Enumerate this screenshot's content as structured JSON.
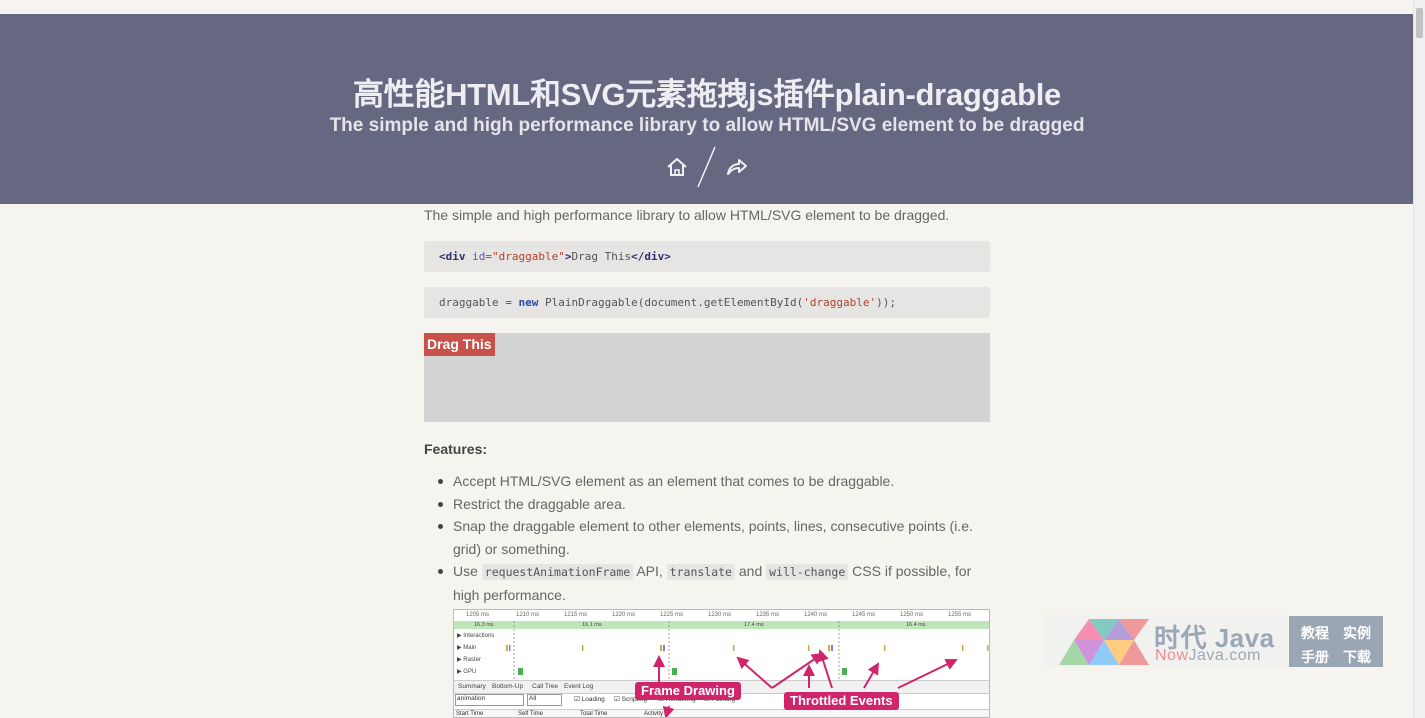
{
  "hero": {
    "title": "高性能HTML和SVG元素拖拽js插件plain-draggable",
    "subtitle": "The simple and high performance library to allow HTML/SVG element to be dragged",
    "icons": [
      "home-icon",
      "share-icon"
    ]
  },
  "content": {
    "intro": "The simple and high performance library to allow HTML/SVG element to be dragged.",
    "code1": {
      "open_tag": "<div",
      "attr": " id=",
      "value": "\"draggable\"",
      "close_open": ">",
      "text": "Drag This",
      "close_tag": "</div>"
    },
    "code2": {
      "lhs": "draggable = ",
      "kw": "new",
      "call": " PlainDraggable(document.getElementById(",
      "arg": "'draggable'",
      "end": "));"
    },
    "drag_label": "Drag This",
    "features_heading": "Features:",
    "features": [
      "Accept HTML/SVG element as an element that comes to be draggable.",
      "Restrict the draggable area.",
      "Snap the draggable element to other elements, points, lines, consecutive points (i.e. grid) or something."
    ],
    "feature4": {
      "pre": "Use ",
      "code_a": "requestAnimationFrame",
      "mid1": " API, ",
      "code_b": "translate",
      "mid2": " and ",
      "code_c": "will-change",
      "post": " CSS if possible, for high performance."
    }
  },
  "timeline": {
    "ticks": [
      "1205 ms",
      "1210 ms",
      "1215 ms",
      "1220 ms",
      "1225 ms",
      "1230 ms",
      "1235 ms",
      "1240 ms",
      "1245 ms",
      "1250 ms",
      "1255 ms"
    ],
    "frames": [
      "16.3 ms",
      "16.1 ms",
      "17.4 ms",
      "16.4 ms"
    ],
    "rows": [
      "▶ Interactions",
      "▶ Main",
      "▶ Raster",
      "▶ GPU"
    ],
    "tabs": [
      "Summary",
      "Bottom-Up",
      "Call Tree",
      "Event Log"
    ],
    "filter_value": "animation",
    "filter_select": "All",
    "checks": [
      "Loading",
      "Scripting",
      "Rendering",
      "Painting"
    ],
    "cols": [
      "Start Time",
      "Self Time",
      "Total Time",
      "Activity"
    ],
    "badge_frame": "Frame Drawing",
    "badge_events": "Throttled  Events"
  },
  "watermark": {
    "brand": "时代 Java",
    "brand2_a": "Now",
    "brand2_b": "Java.com",
    "links": [
      "教程",
      "实例",
      "手册",
      "下载"
    ]
  },
  "colors": {
    "hero_bg": "#666881",
    "drag_bg": "#c9514c",
    "badge": "#d0246b"
  }
}
